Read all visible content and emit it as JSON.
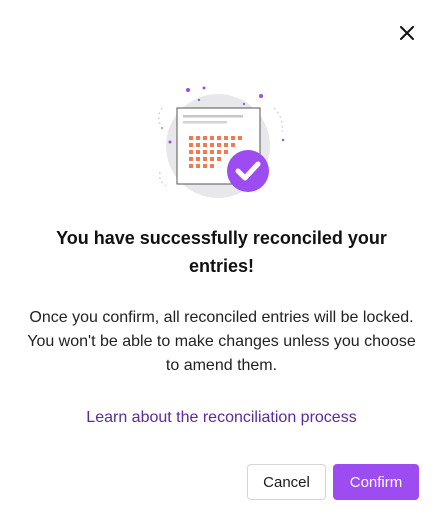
{
  "dialog": {
    "title": "You have successfully reconciled your entries!",
    "body": "Once you confirm, all reconciled entries will be locked. You won't be able to make changes unless you choose to amend them.",
    "learn_link": "Learn about the reconciliation process",
    "cancel_label": "Cancel",
    "confirm_label": "Confirm"
  },
  "icons": {
    "close": "close-icon",
    "illustration": "calendar-check-illustration"
  },
  "colors": {
    "accent": "#9c4cf0",
    "link": "#5b2a9c",
    "calendar_dots": "#f07a52"
  }
}
